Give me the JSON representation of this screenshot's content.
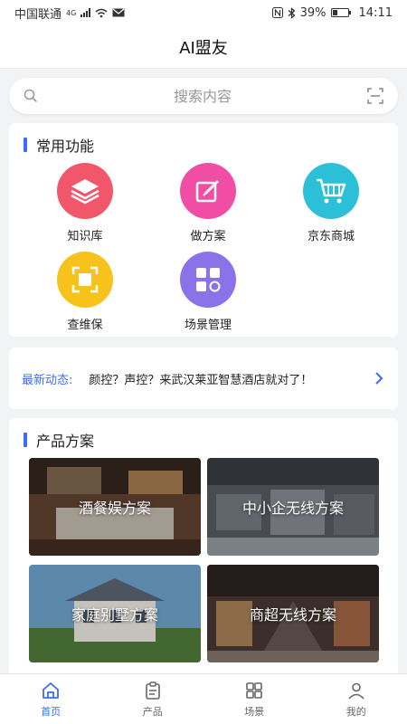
{
  "status": {
    "carrier": "中国联通",
    "network": "4G",
    "battery_text": "39%",
    "battery_level": 0.39,
    "time": "14:11"
  },
  "app": {
    "title": "AI盟友"
  },
  "search": {
    "placeholder": "搜索内容"
  },
  "functions": {
    "title": "常用功能",
    "items": [
      {
        "label": "知识库",
        "color": "#f2566a",
        "icon": "layers-icon"
      },
      {
        "label": "做方案",
        "color": "#f04ea5",
        "icon": "edit-icon"
      },
      {
        "label": "京东商城",
        "color": "#2bbfd8",
        "icon": "cart-icon"
      },
      {
        "label": "查维保",
        "color": "#f7c21c",
        "icon": "scan-frame-icon"
      },
      {
        "label": "场景管理",
        "color": "#8a72e8",
        "icon": "grid-icon"
      }
    ]
  },
  "news": {
    "tag": "最新动态:",
    "text": "颜控？声控？来武汉莱亚智慧酒店就对了！"
  },
  "products": {
    "title": "产品方案",
    "items": [
      {
        "label": "酒餐娱方案"
      },
      {
        "label": "中小企无线方案"
      },
      {
        "label": "家庭别墅方案"
      },
      {
        "label": "商超无线方案"
      }
    ]
  },
  "tabs": [
    {
      "label": "首页",
      "icon": "home-icon",
      "active": true
    },
    {
      "label": "产品",
      "icon": "clipboard-icon",
      "active": false
    },
    {
      "label": "场景",
      "icon": "grid-icon",
      "active": false
    },
    {
      "label": "我的",
      "icon": "user-icon",
      "active": false
    }
  ],
  "accent_color": "#3b6cf6"
}
